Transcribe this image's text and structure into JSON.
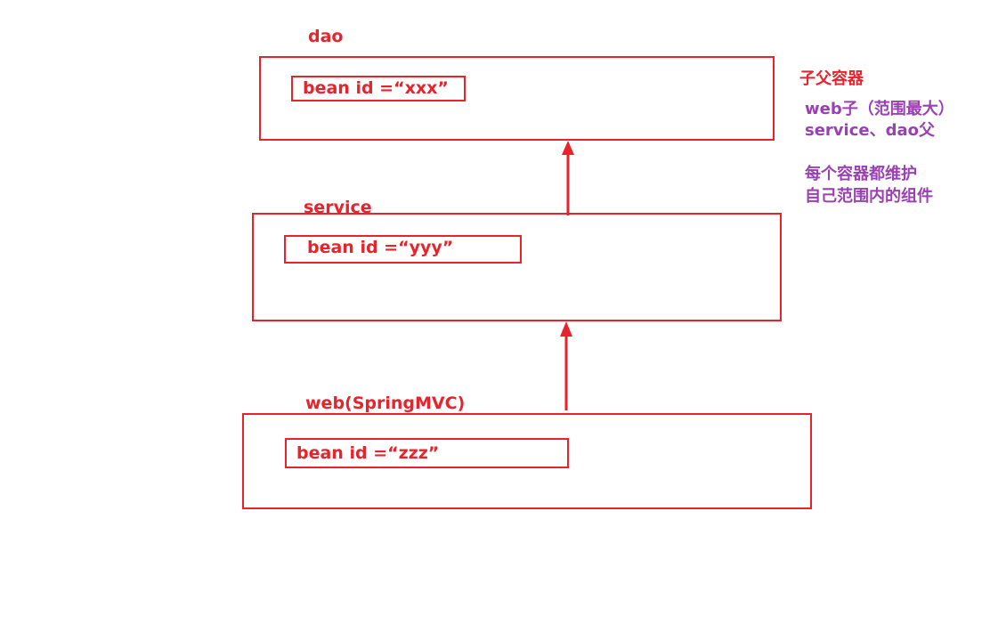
{
  "colors": {
    "primary": "#e8232b",
    "note": "#9b3fb5"
  },
  "containers": {
    "dao": {
      "label": "dao",
      "bean": "bean id =“xxx”"
    },
    "service": {
      "label": "service",
      "bean": "bean id =“yyy”"
    },
    "web": {
      "label": "web(SpringMVC)",
      "bean": "bean id =“zzz”"
    }
  },
  "notes": {
    "title": "子父容器",
    "line1": "web子（范围最大）",
    "line2": "service、dao父",
    "line3": "每个容器都维护",
    "line4": "自己范围内的组件"
  },
  "arrows": [
    {
      "from": "service",
      "to": "dao"
    },
    {
      "from": "web",
      "to": "service"
    }
  ]
}
